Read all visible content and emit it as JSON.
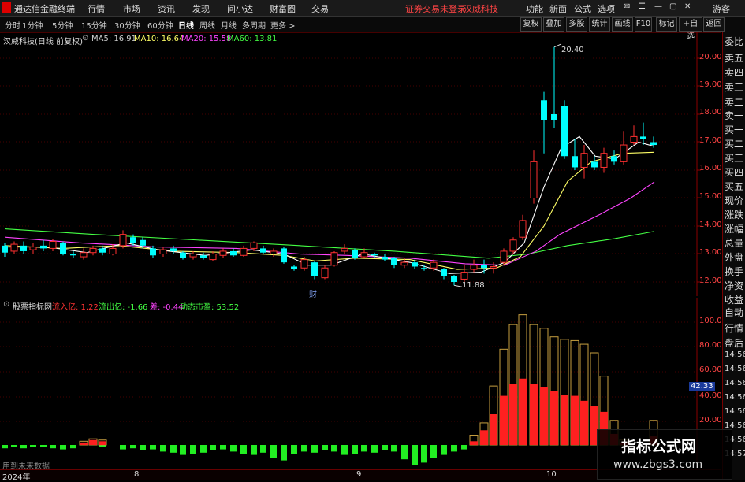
{
  "menubar": {
    "app_title": "通达信金融终端",
    "items": [
      "行情",
      "市场",
      "资讯",
      "发现",
      "问小达",
      "财富圈",
      "交易"
    ],
    "login_notice": "证券交易未登录",
    "stock_name": "汉威科技",
    "right_items": [
      "功能",
      "新面",
      "公式",
      "选项",
      "游客"
    ]
  },
  "periodbar": {
    "periods": [
      "分时",
      "1分钟",
      "5分钟",
      "15分钟",
      "30分钟",
      "60分钟",
      "日线",
      "周线",
      "月线",
      "多周期",
      "更多 >"
    ],
    "active": "日线",
    "right_buttons": [
      "复权",
      "叠加",
      "多股",
      "统计",
      "画线",
      "F10",
      "标记",
      "+自选",
      "返回"
    ]
  },
  "main_chart": {
    "title": "汉威科技(日线 前复权)",
    "ma": [
      {
        "label": "MA5: 16.91",
        "color": "#ffffff"
      },
      {
        "label": "MA10: 16.64",
        "color": "#ffff66"
      },
      {
        "label": "MA20: 15.58",
        "color": "#ff44ff"
      },
      {
        "label": "MA60: 13.81",
        "color": "#44ff44"
      }
    ],
    "y_ticks": [
      "20.00",
      "19.00",
      "18.00",
      "17.00",
      "16.00",
      "15.00",
      "14.00",
      "13.00",
      "12.00"
    ],
    "high_label": "20.40",
    "low_label": "11.88",
    "event_marker": "财"
  },
  "sub_chart": {
    "title": "股票指标网",
    "items": [
      {
        "label": "流入亿: 1.22",
        "color": "#ff3333"
      },
      {
        "label": "流出亿: -1.66",
        "color": "#44ff44"
      },
      {
        "label": "差: -0.44",
        "color": "#ff44ff"
      },
      {
        "label": "动态市盈: 53.52",
        "color": "#44ff44"
      }
    ],
    "y_ticks": [
      "100.0",
      "80.00",
      "60.00",
      "40.00",
      "20.00"
    ],
    "current_value": "42.33",
    "footer_note": "用到未来数据"
  },
  "axis": {
    "labels": [
      "2024年",
      "8",
      "9",
      "10"
    ]
  },
  "right_panel": {
    "items": [
      "委比",
      "卖五",
      "卖四",
      "卖三",
      "卖二",
      "卖一",
      "买一",
      "买二",
      "买三",
      "买四",
      "买五",
      "现价",
      "涨跌",
      "涨幅",
      "总量",
      "外盘",
      "换手",
      "净资",
      "收益",
      "自动",
      "行情",
      "盘后",
      "14:56",
      "14:56",
      "14:56",
      "14:56",
      "14:56",
      "14:56",
      "14:56",
      "14:57"
    ]
  },
  "watermark": {
    "title": "指标公式网",
    "url": "www.zbgs3.com"
  },
  "colors": {
    "up": "#ff3030",
    "down": "#00ffff",
    "grid": "#8b0000",
    "inflow": "#ff2020",
    "outflow": "#22ee22",
    "outline": "#c8a040"
  }
}
